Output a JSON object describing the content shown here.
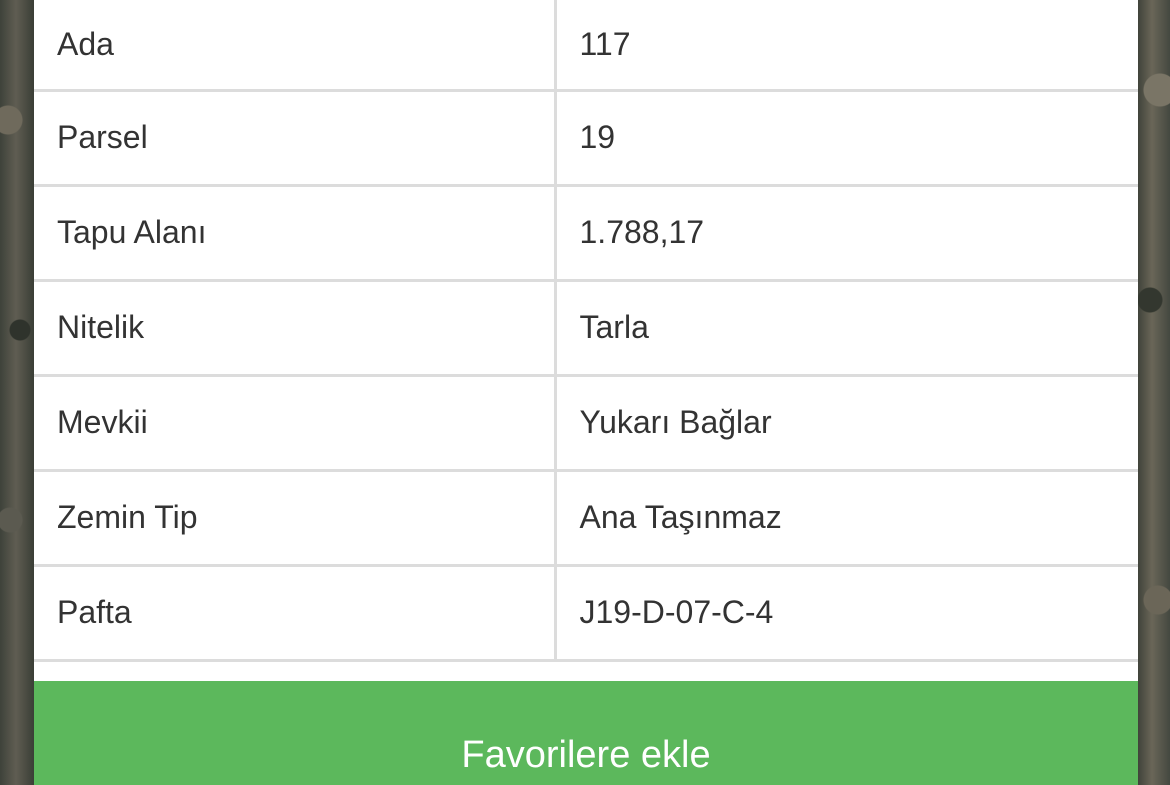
{
  "parcel_info": {
    "rows": [
      {
        "label": "Ada",
        "value": "117"
      },
      {
        "label": "Parsel",
        "value": "19"
      },
      {
        "label": "Tapu Alanı",
        "value": "1.788,17"
      },
      {
        "label": "Nitelik",
        "value": "Tarla"
      },
      {
        "label": "Mevkii",
        "value": "Yukarı Bağlar"
      },
      {
        "label": "Zemin Tip",
        "value": "Ana Taşınmaz"
      },
      {
        "label": "Pafta",
        "value": "J19-D-07-C-4"
      }
    ]
  },
  "actions": {
    "favorite_label": "Favorilere ekle"
  },
  "colors": {
    "button_green": "#5cb85c",
    "border_gray": "#dcdcdc",
    "text_dark": "#333333"
  }
}
